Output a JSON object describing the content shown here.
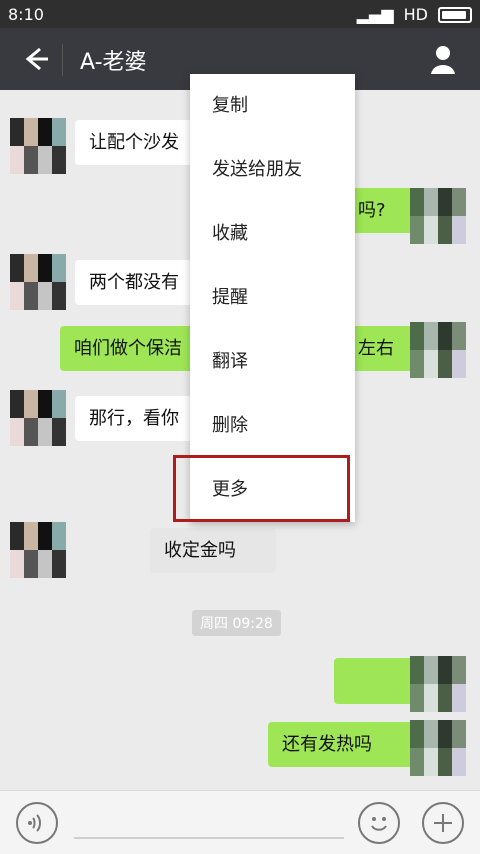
{
  "status_bar": {
    "time": "8:10",
    "network": "HD"
  },
  "header": {
    "title": "A-老婆"
  },
  "messages": [
    {
      "text": "让配个沙发"
    },
    {
      "text": "吗?"
    },
    {
      "text": "两个都没有"
    },
    {
      "text": "咱们做个保洁"
    },
    {
      "text": "左右"
    },
    {
      "text": "那行，看你"
    },
    {
      "text": "收定金吗"
    },
    {
      "text": "还有发热吗"
    }
  ],
  "time_divider": "周四 09:28",
  "context_menu": {
    "items": [
      "复制",
      "发送给朋友",
      "收藏",
      "提醒",
      "翻译",
      "删除",
      "更多"
    ]
  },
  "icons": {
    "back": "back-arrow-icon",
    "profile": "profile-icon",
    "voice": "voice-icon",
    "emoji": "emoji-icon",
    "plus": "plus-icon"
  },
  "colors": {
    "accent": "#9fe656",
    "highlight": "#b01c1c"
  }
}
